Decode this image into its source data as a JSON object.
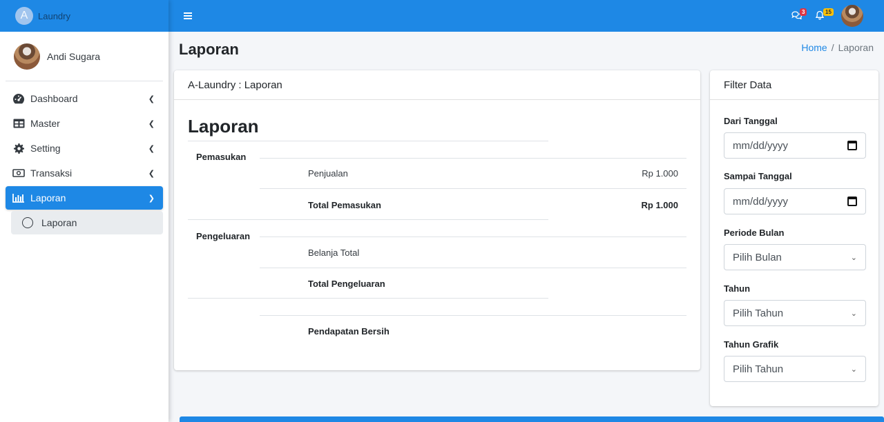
{
  "brand": {
    "logo_letter": "A",
    "name": "Laundry"
  },
  "user": {
    "name": "Andi Sugara"
  },
  "sidebar": {
    "items": [
      {
        "label": "Dashboard",
        "icon": "tachometer-icon"
      },
      {
        "label": "Master",
        "icon": "table-icon"
      },
      {
        "label": "Setting",
        "icon": "cog-icon"
      },
      {
        "label": "Transaksi",
        "icon": "money-bill-icon"
      },
      {
        "label": "Laporan",
        "icon": "chart-bar-icon",
        "active": true
      }
    ],
    "sub_item": {
      "label": "Laporan",
      "icon": "circle-outline-icon"
    }
  },
  "navbar": {
    "messages_count": "3",
    "notifications_count": "15"
  },
  "page": {
    "title": "Laporan",
    "breadcrumb": {
      "home": "Home",
      "separator": "/",
      "current": "Laporan"
    }
  },
  "report_card": {
    "header": "A-Laundry : Laporan",
    "title": "Laporan",
    "pemasukan": {
      "label": "Pemasukan",
      "rows": [
        {
          "label": "Penjualan",
          "value": "Rp 1.000"
        },
        {
          "label": "Total Pemasukan",
          "value": "Rp 1.000"
        }
      ]
    },
    "pengeluaran": {
      "label": "Pengeluaran",
      "rows": [
        {
          "label": "Belanja Total",
          "value": ""
        },
        {
          "label": "Total Pengeluaran",
          "value": ""
        }
      ]
    },
    "net": {
      "label": "Pendapatan Bersih",
      "value": ""
    }
  },
  "filter_card": {
    "header": "Filter Data",
    "from_label": "Dari Tanggal",
    "from_value": "mm/dd/yyyy",
    "to_label": "Sampai Tanggal",
    "to_value": "mm/dd/yyyy",
    "month_label": "Periode Bulan",
    "month_value": "Pilih Bulan",
    "year_label": "Tahun",
    "year_value": "Pilih Tahun",
    "chart_year_label": "Tahun Grafik",
    "chart_year_value": "Pilih Tahun"
  },
  "colors": {
    "primary": "#1e88e5",
    "danger": "#dc3545",
    "warning": "#ffc107"
  }
}
